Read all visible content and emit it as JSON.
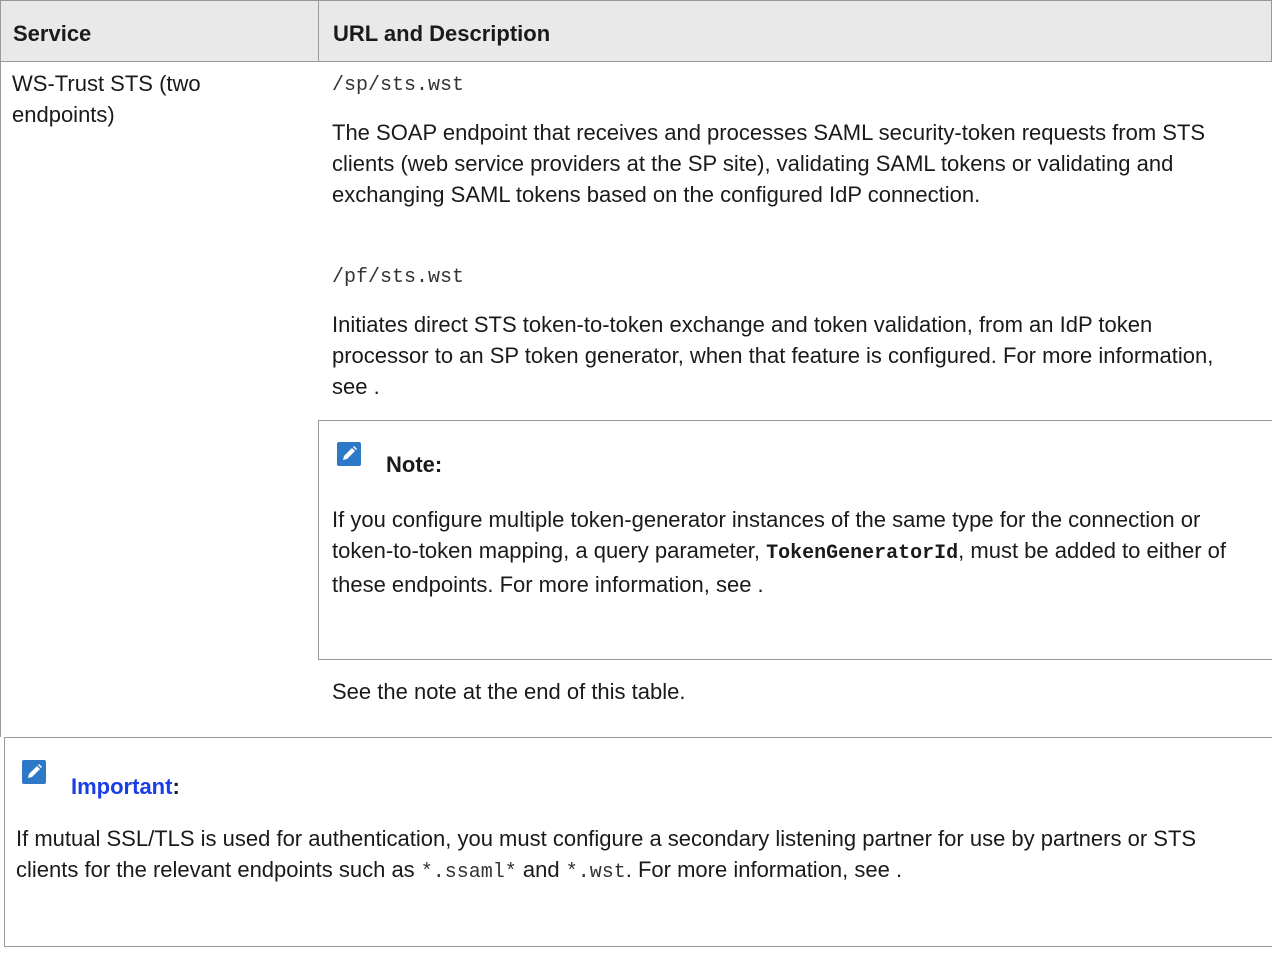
{
  "table": {
    "header_service": "Service",
    "header_url": "URL and Description",
    "row_service": "WS-Trust STS (two endpoints)",
    "path1": "/sp/sts.wst",
    "desc1": "The SOAP endpoint that receives and processes SAML security-token requests from STS clients (web service providers at the SP site), validating SAML tokens or validating and exchanging SAML tokens based on the configured IdP connection.",
    "path2": "/pf/sts.wst",
    "desc2": "Initiates direct STS token-to-token exchange and token validation, from an IdP token processor to an SP token generator, when that feature is configured. For more information, see .",
    "note_label": "Note:",
    "note_text_before": "If you configure multiple token-generator instances of the same type for the connection or token-to-token mapping, a query parameter, ",
    "note_code": "TokenGeneratorId",
    "note_text_after": ", must be added to either of these endpoints. For more information, see .",
    "see_note": "See the note at the end of this table."
  },
  "important": {
    "label": "Important",
    "colon": ":",
    "text_before": "If mutual SSL/TLS is used for authentication, you must configure a secondary  listening partner for use by partners or STS clients for the relevant endpoints such as ",
    "code1": "*.ssaml*",
    "text_mid": " and ",
    "code2": "*.wst",
    "text_after": ". For more information, see ."
  },
  "colors": {
    "header_bg": "#e9e9e9",
    "icon": "#2d78c7",
    "link": "#1a3ee6",
    "border": "#9a9a9a"
  },
  "icons": [
    "pencil-note-icon",
    "pencil-important-icon"
  ]
}
